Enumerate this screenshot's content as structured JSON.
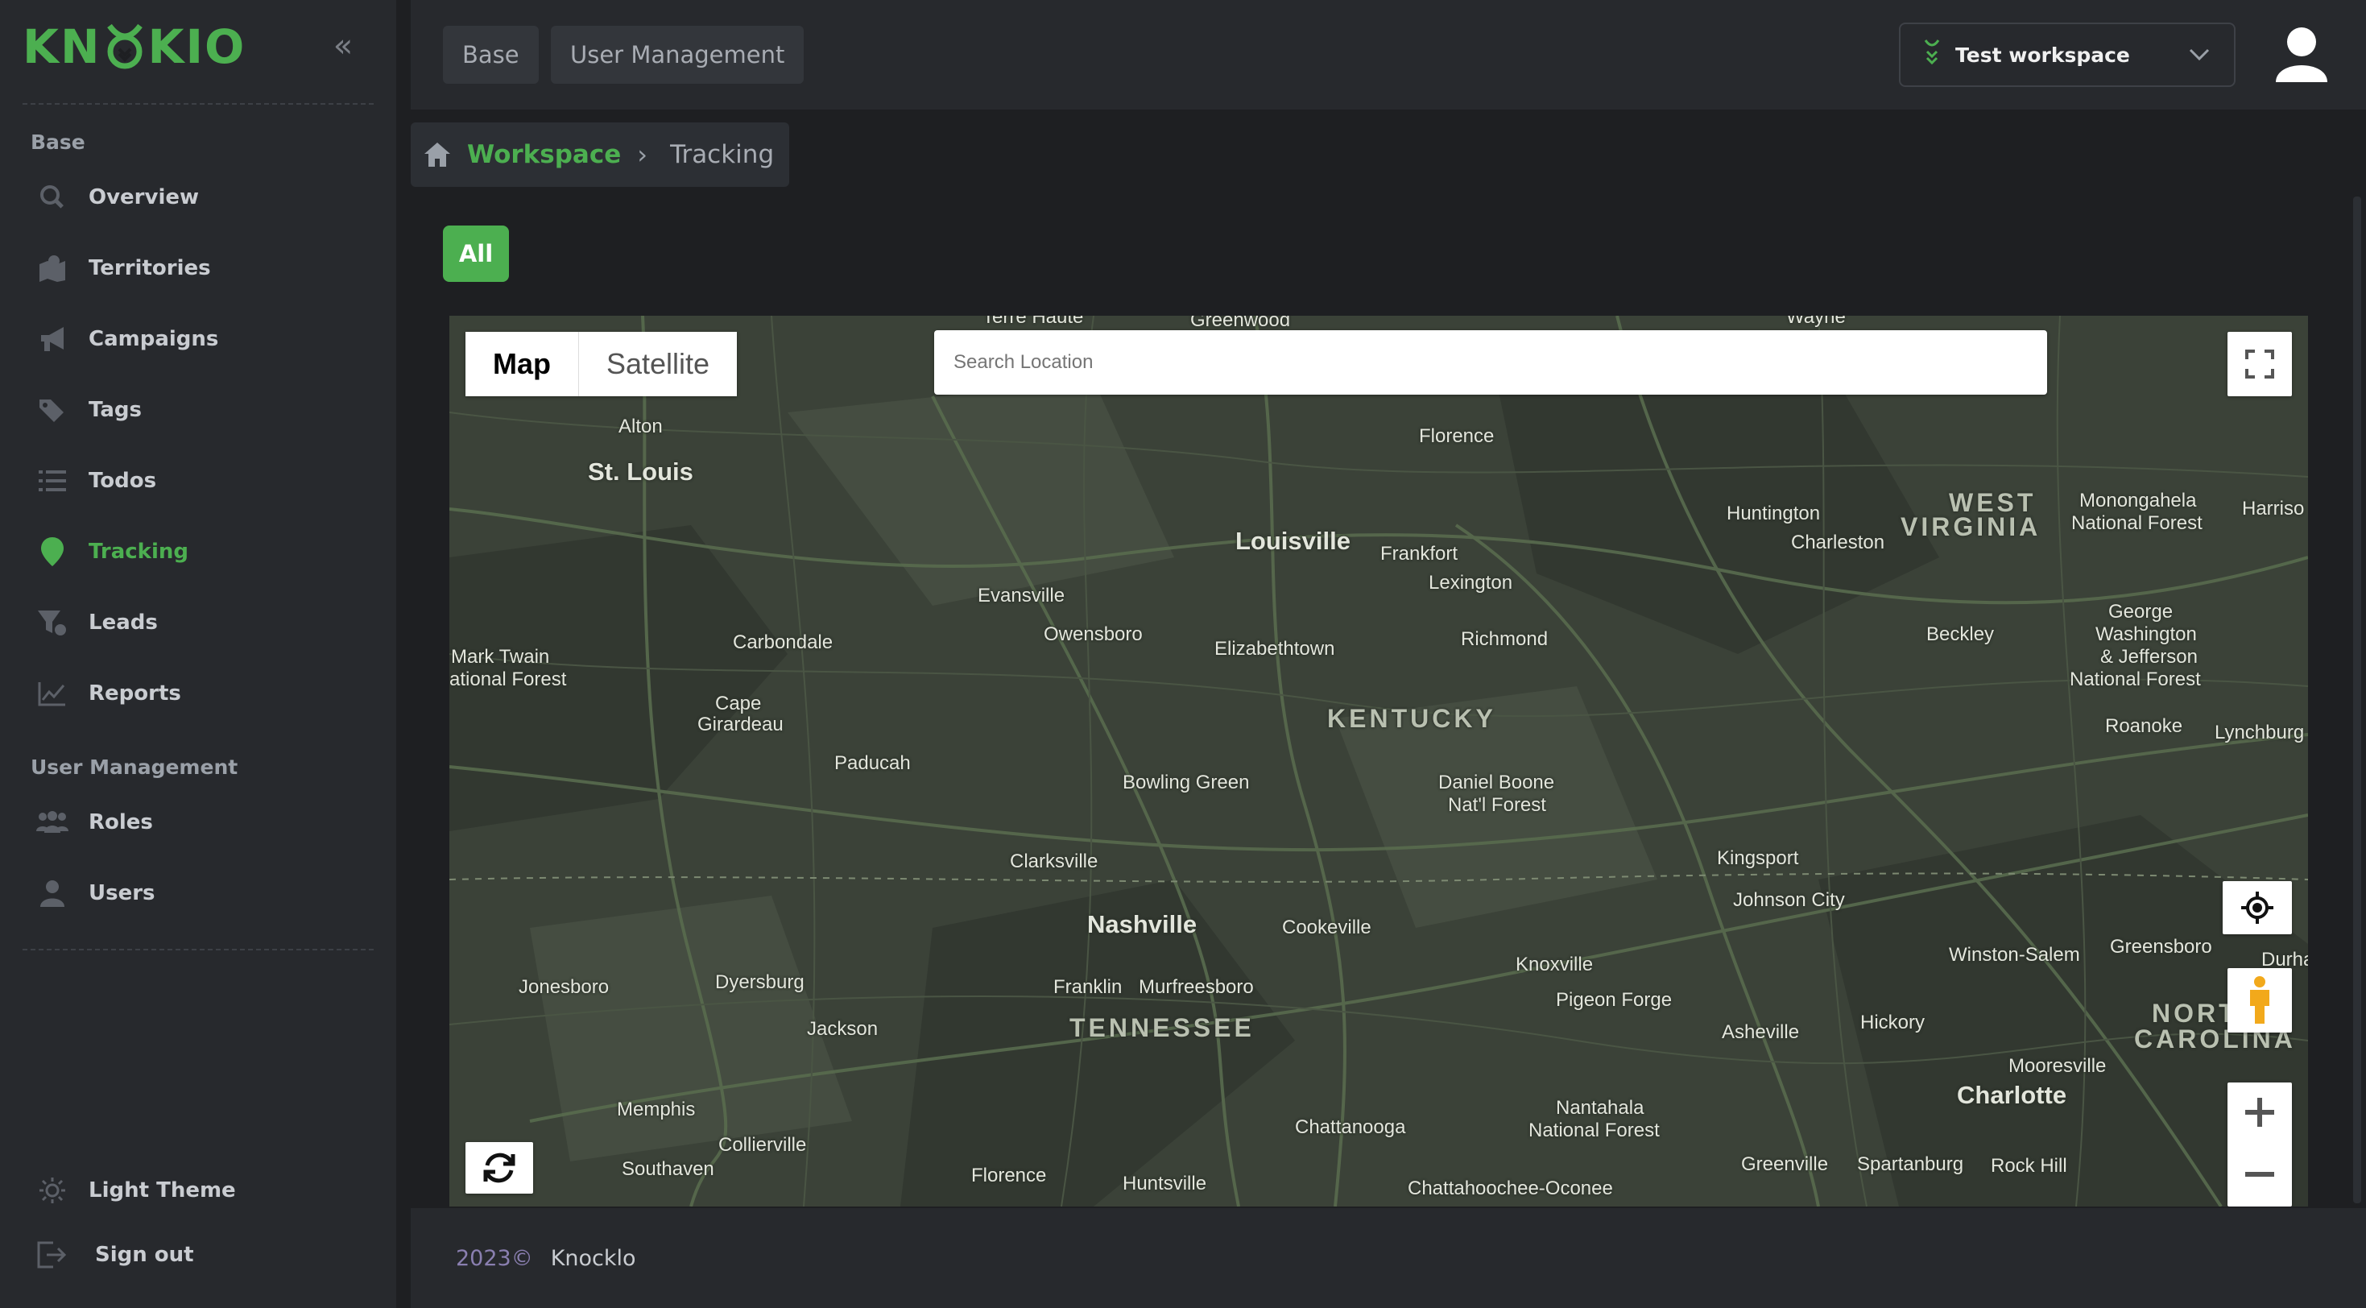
{
  "brand": {
    "name_left": "KN",
    "name_right": "KIO",
    "accent": "#4caf50"
  },
  "sidebar": {
    "sections": [
      {
        "title": "Base"
      },
      {
        "title": "User Management"
      }
    ],
    "items": [
      {
        "label": "Overview",
        "icon": "search-icon"
      },
      {
        "label": "Territories",
        "icon": "territories-icon"
      },
      {
        "label": "Campaigns",
        "icon": "megaphone-icon"
      },
      {
        "label": "Tags",
        "icon": "tag-icon"
      },
      {
        "label": "Todos",
        "icon": "list-icon"
      },
      {
        "label": "Tracking",
        "icon": "location-pin-icon",
        "active": true
      },
      {
        "label": "Leads",
        "icon": "filter-icon"
      },
      {
        "label": "Reports",
        "icon": "line-chart-icon"
      },
      {
        "label": "Roles",
        "icon": "group-icon"
      },
      {
        "label": "Users",
        "icon": "user-icon"
      }
    ],
    "bottom": [
      {
        "label": "Light Theme",
        "icon": "sun-icon"
      },
      {
        "label": "Sign out",
        "icon": "sign-out-icon"
      }
    ]
  },
  "topbar": {
    "tabs": [
      "Base",
      "User Management"
    ],
    "workspace": "Test workspace"
  },
  "breadcrumb": {
    "workspace": "Workspace",
    "current": "Tracking"
  },
  "filter": {
    "all_label": "All"
  },
  "map": {
    "type_options": [
      "Map",
      "Satellite"
    ],
    "selected_type": "Map",
    "search_placeholder": "Search Location",
    "labels": {
      "terre_haute": "Terre Haute",
      "greenwood": "Greenwood",
      "wayne": "Wayne",
      "alton": "Alton",
      "st_louis": "St. Louis",
      "florence_ky": "Florence",
      "louisville": "Louisville",
      "frankfort": "Frankfort",
      "lexington": "Lexington",
      "huntington": "Huntington",
      "charleston": "Charleston",
      "west": "WEST",
      "virginia": "VIRGINIA",
      "monongahela": "Monongahela",
      "national_forest": "National Forest",
      "harriso": "Harriso",
      "evansville": "Evansville",
      "owensboro": "Owensboro",
      "elizabethtown": "Elizabethtown",
      "richmond": "Richmond",
      "carbondale": "Carbondale",
      "mark_twain": "Mark Twain",
      "ational_forest": "ational Forest",
      "beckley": "Beckley",
      "george": "George",
      "washington": "Washington",
      "jefferson": "& Jefferson",
      "national_forest2": "National Forest",
      "cape": "Cape",
      "girardeau": "Girardeau",
      "kentucky": "KENTUCKY",
      "roanoke": "Roanoke",
      "lynchburg": "Lynchburg",
      "paducah": "Paducah",
      "bowling_green": "Bowling Green",
      "daniel_boone": "Daniel Boone",
      "natl_forest": "Nat'l Forest",
      "clarksville": "Clarksville",
      "kingsport": "Kingsport",
      "johnson_city": "Johnson City",
      "nashville": "Nashville",
      "cookeville": "Cookeville",
      "winston_salem": "Winston-Salem",
      "greensboro": "Greensboro",
      "durha": "Durha",
      "jonesboro": "Jonesboro",
      "dyersburg": "Dyersburg",
      "franklin": "Franklin",
      "murfreesboro": "Murfreesboro",
      "knoxville": "Knoxville",
      "pigeon_forge": "Pigeon Forge",
      "nort": "NORT",
      "jackson": "Jackson",
      "tennessee": "TENNESSEE",
      "asheville": "Asheville",
      "hickory": "Hickory",
      "carolina": "CAROLINA",
      "mooresville": "Mooresville",
      "charlotte": "Charlotte",
      "memphis": "Memphis",
      "nantahala": "Nantahala",
      "national_forest3": "National Forest",
      "chattanooga": "Chattanooga",
      "collierville": "Collierville",
      "southaven": "Southaven",
      "greenville": "Greenville",
      "spartanburg": "Spartanburg",
      "rock_hill": "Rock Hill",
      "florence_al": "Florence",
      "huntsville": "Huntsville",
      "chattahoochee": "Chattahoochee-Oconee"
    }
  },
  "footer": {
    "year": "2023©",
    "brand": "Knocklo"
  }
}
